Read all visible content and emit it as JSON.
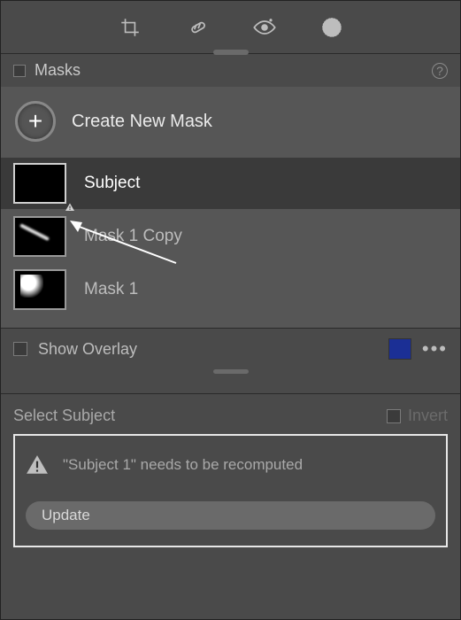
{
  "header": {
    "title": "Masks"
  },
  "toolbar": {
    "icons": [
      "crop-icon",
      "heal-icon",
      "redeye-icon",
      "radial-icon"
    ]
  },
  "create": {
    "label": "Create New Mask"
  },
  "masks": [
    {
      "label": "Subject",
      "selected": true,
      "warning": true,
      "thumb": "blank"
    },
    {
      "label": "Mask 1 Copy",
      "selected": false,
      "warning": false,
      "thumb": "streak"
    },
    {
      "label": "Mask 1",
      "selected": false,
      "warning": false,
      "thumb": "blob"
    }
  ],
  "footer": {
    "show_overlay_label": "Show Overlay",
    "swatch_color": "#1b2f95"
  },
  "select_subject": {
    "title": "Select Subject",
    "invert_label": "Invert",
    "notice_msg": "\"Subject 1\" needs to be recomputed",
    "update_label": "Update"
  }
}
